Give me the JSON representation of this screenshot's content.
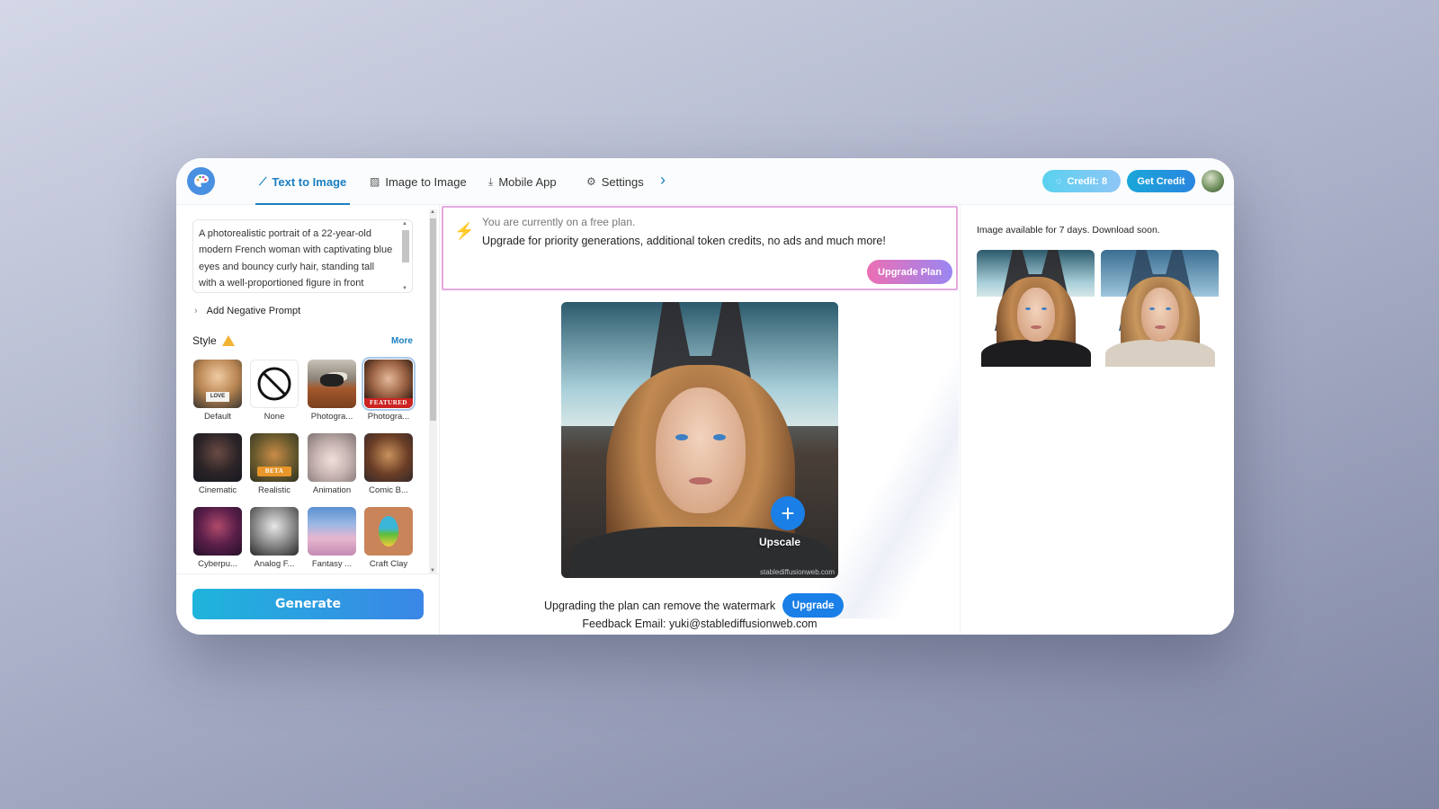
{
  "nav": {
    "tabs": [
      {
        "label": "Text to Image",
        "icon": "magic-wand-icon",
        "active": true
      },
      {
        "label": "Image to Image",
        "icon": "image-icon",
        "active": false
      },
      {
        "label": "Mobile App",
        "icon": "download-icon",
        "active": false
      },
      {
        "label": "Settings",
        "icon": "gear-icon",
        "active": false
      }
    ],
    "more_icon": "chevron-right-icon",
    "credit_label": "Credit: 8",
    "get_credit_label": "Get Credit"
  },
  "left": {
    "prompt_value": "A photorealistic portrait of a 22-year-old modern French woman with captivating blue eyes and bouncy curly hair, standing tall with a well-proportioned figure in front",
    "negative_prompt_label": "Add Negative Prompt",
    "style_label": "Style",
    "more_label": "More",
    "styles": [
      {
        "label": "Default",
        "badge": ""
      },
      {
        "label": "None",
        "badge": ""
      },
      {
        "label": "Photogra...",
        "badge": ""
      },
      {
        "label": "Photogra...",
        "badge": "FEATURED",
        "selected": true
      },
      {
        "label": "Cinematic",
        "badge": ""
      },
      {
        "label": "Realistic",
        "badge": "BETA"
      },
      {
        "label": "Animation",
        "badge": ""
      },
      {
        "label": "Comic B...",
        "badge": ""
      },
      {
        "label": "Cyberpu...",
        "badge": ""
      },
      {
        "label": "Analog F...",
        "badge": ""
      },
      {
        "label": "Fantasy ...",
        "badge": ""
      },
      {
        "label": "Craft Clay",
        "badge": ""
      }
    ],
    "default_thumb_text": "LOVE",
    "generate_label": "Generate"
  },
  "banner": {
    "line1": "You are currently on a free plan.",
    "line2": "Upgrade for priority generations, additional token credits, no ads and much more!",
    "button": "Upgrade Plan"
  },
  "result": {
    "upscale_label": "Upscale",
    "watermark": "stablediffusionweb.com",
    "watermark_note": "Upgrading the plan can remove the watermark",
    "upgrade_label": "Upgrade",
    "feedback": "Feedback Email: yuki@stablediffusionweb.com"
  },
  "history": {
    "note": "Image available for 7 days. Download soon.",
    "count": 2
  },
  "colors": {
    "accent": "#1a7fc0",
    "upgrade_blue": "#1a7fe6",
    "banner_border": "#e3a9e0",
    "bolt": "#f07c2c"
  }
}
